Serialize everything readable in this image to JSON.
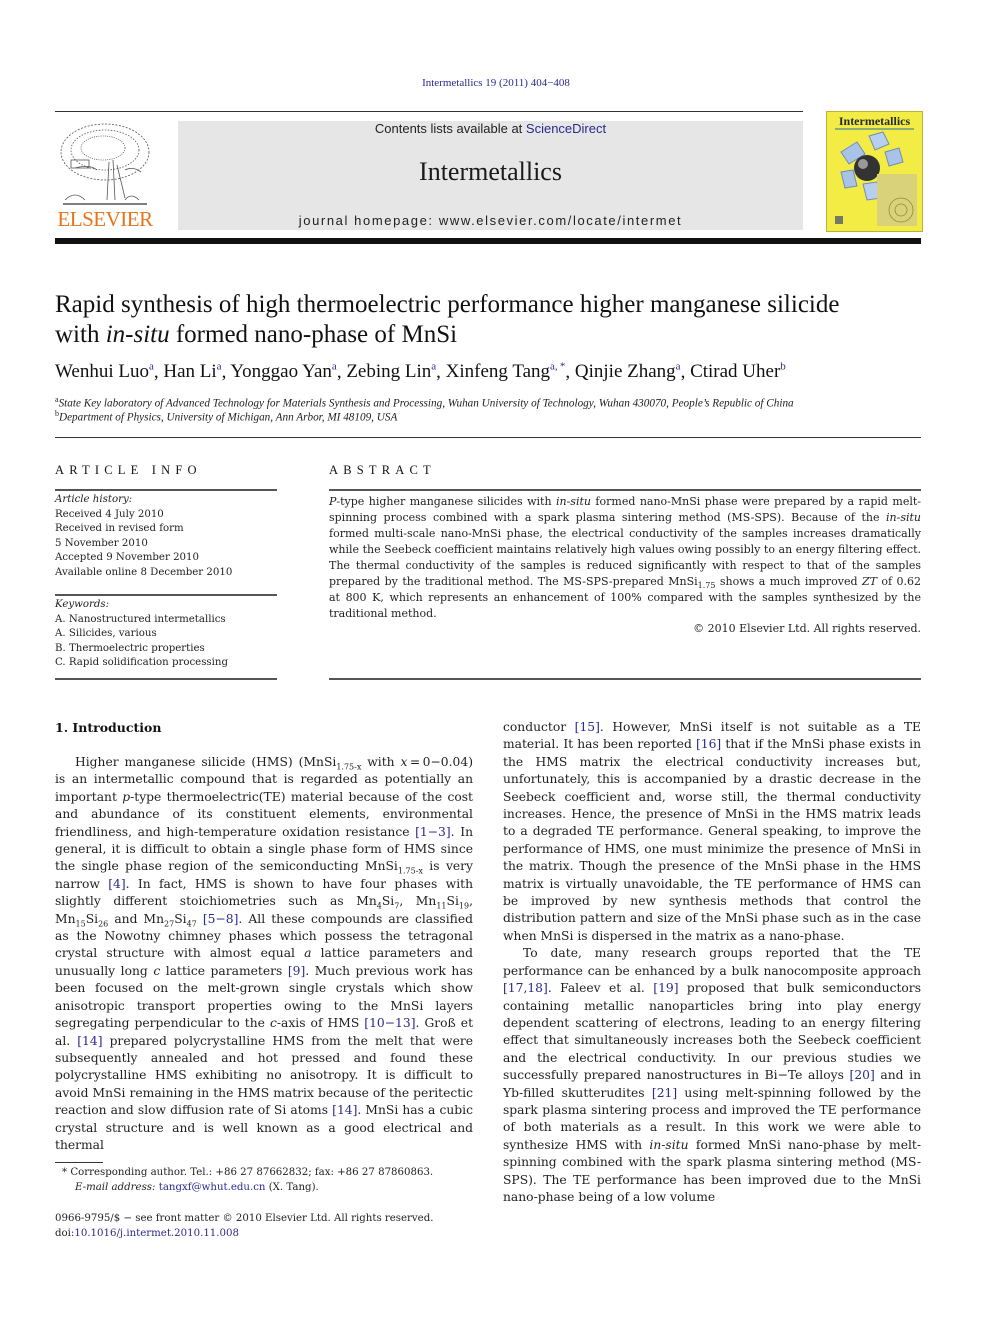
{
  "header": {
    "citation": "Intermetallics 19 (2011) 404−408",
    "contents_prefix": "Contents lists available at ",
    "contents_link": "ScienceDirect",
    "journal_name": "Intermetallics",
    "homepage": "journal homepage: www.elsevier.com/locate/intermet",
    "publisher_logo_text": "ELSEVIER",
    "cover_title": "Intermetallics",
    "colors": {
      "publisher_orange": "#e8731a",
      "banner_gray": "#e6e6e6",
      "cover_yellow": "#f2ec45",
      "link_blue": "#2a2a8c"
    }
  },
  "article": {
    "title_part1": "Rapid synthesis of high thermoelectric performance higher manganese silicide",
    "title_part2_prefix": "with ",
    "title_part2_italic": "in-situ",
    "title_part2_suffix": " formed nano-phase of MnSi",
    "authors": [
      {
        "name": "Wenhui Luo",
        "aff": "a"
      },
      {
        "name": "Han Li",
        "aff": "a"
      },
      {
        "name": "Yonggao Yan",
        "aff": "a"
      },
      {
        "name": "Zebing Lin",
        "aff": "a"
      },
      {
        "name": "Xinfeng Tang",
        "aff": "a, *"
      },
      {
        "name": "Qinjie Zhang",
        "aff": "a"
      },
      {
        "name": "Ctirad Uher",
        "aff": "b"
      }
    ],
    "affiliations": [
      {
        "key": "a",
        "text": "State Key laboratory of Advanced Technology for Materials Synthesis and Processing, Wuhan University of Technology, Wuhan 430070, People’s Republic of China"
      },
      {
        "key": "b",
        "text": "Department of Physics, University of Michigan, Ann Arbor, MI 48109, USA"
      }
    ]
  },
  "article_info": {
    "heading": "ARTICLE INFO",
    "history_label": "Article history:",
    "history": [
      "Received 4 July 2010",
      "Received in revised form",
      "5 November 2010",
      "Accepted 9 November 2010",
      "Available online 8 December 2010"
    ],
    "keywords_label": "Keywords:",
    "keywords": [
      "A. Nanostructured intermetallics",
      "A. Silicides, various",
      "B. Thermoelectric properties",
      "C. Rapid solidification processing"
    ]
  },
  "abstract": {
    "heading": "ABSTRACT",
    "s1_italic": "P",
    "s1_a": "-type higher manganese silicides with ",
    "s1_italic2": "in-situ",
    "s1_b": " formed nano-MnSi phase were prepared by a rapid melt-spinning process combined with a spark plasma sintering method (MS-SPS). Because of the ",
    "s1_italic3": "in-situ",
    "s1_c": " formed multi-scale nano-MnSi phase, the electrical conductivity of the samples increases dramatically while the Seebeck coefficient maintains relatively high values owing possibly to an energy filtering effect. The thermal conductivity of the samples is reduced significantly with respect to that of the samples prepared by the traditional method. The MS-SPS-prepared MnSi",
    "s1_sub": "1.75",
    "s1_d": " shows a much improved ",
    "s1_italic4": "ZT",
    "s1_e": " of 0.62 at 800 K, which represents an enhancement of 100% compared with the samples synthesized by the traditional method.",
    "copyright": "© 2010 Elsevier Ltd. All rights reserved."
  },
  "intro": {
    "heading": "1.  Introduction",
    "left_col_html_parts": {
      "p1": "Higher manganese silicide (HMS) (MnSi<sub>1.75-x</sub> with <i>x</i> = 0−0.04) is an intermetallic compound that is regarded as potentially an important <i>p</i>-type thermoelectric(TE) material because of the cost and abundance of its constituent elements, environmental friendliness, and high-temperature oxidation resistance <span class=\"ref\">[1−3]</span>. In general, it is difficult to obtain a single phase form of HMS since the single phase region of the semiconducting MnSi<sub>1.75-x</sub> is very narrow <span class=\"ref\">[4]</span>. In fact, HMS is shown to have four phases with slightly different stoichiometries such as Mn<sub>4</sub>Si<sub>7</sub>, Mn<sub>11</sub>Si<sub>19</sub>, Mn<sub>15</sub>Si<sub>26</sub> and Mn<sub>27</sub>Si<sub>47</sub> <span class=\"ref\">[5−8]</span>. All these compounds are classified as the Nowotny chimney phases which possess the tetragonal crystal structure with almost equal <i>a</i> lattice parameters and unusually long <i>c</i> lattice parameters <span class=\"ref\">[9]</span>. Much previous work has been focused on the melt-grown single crystals which show anisotropic transport properties owing to the MnSi layers segregating perpendicular to the <i>c</i>-axis of HMS <span class=\"ref\">[10−13]</span>. Groß et al. <span class=\"ref\">[14]</span> prepared polycrystalline HMS from the melt that were subsequently annealed and hot pressed and found these polycrystalline HMS exhibiting no anisotropy. It is difficult to avoid MnSi remaining in the HMS matrix because of the peritectic reaction and slow diffusion rate of Si atoms <span class=\"ref\">[14]</span>. MnSi has a cubic crystal structure and is well known as a good electrical and thermal"
    },
    "right_col_html_parts": {
      "p1": "conductor <span class=\"ref\">[15]</span>. However, MnSi itself is not suitable as a TE material. It has been reported <span class=\"ref\">[16]</span> that if the MnSi phase exists in the HMS matrix the electrical conductivity increases but, unfortunately, this is accompanied by a drastic decrease in the Seebeck coefficient and, worse still, the thermal conductivity increases. Hence, the presence of MnSi in the HMS matrix leads to a degraded TE performance. General speaking, to improve the performance of HMS, one must minimize the presence of MnSi in the matrix. Though the presence of the MnSi phase in the HMS matrix is virtually unavoidable, the TE performance of HMS can be improved by new synthesis methods that control the distribution pattern and size of the MnSi phase such as in the case when MnSi is dispersed in the matrix as a nano-phase.",
      "p2": "To date, many research groups reported that the TE performance can be enhanced by a bulk nanocomposite approach <span class=\"ref\">[17,18]</span>. Faleev et al. <span class=\"ref\">[19]</span> proposed that bulk semiconductors containing metallic nanoparticles bring into play energy dependent scattering of electrons, leading to an energy filtering effect that simultaneously increases both the Seebeck coefficient and the electrical conductivity. In our previous studies we successfully prepared nanostructures in Bi−Te alloys <span class=\"ref\">[20]</span> and in Yb-filled skutterudites <span class=\"ref\">[21]</span> using melt-spinning followed by the spark plasma sintering process and improved the TE performance of both materials as a result. In this work we were able to synthesize HMS with <i>in-situ</i> formed MnSi nano-phase by melt-spinning combined with the spark plasma sintering method (MS-SPS). The TE performance has been improved due to the MnSi nano-phase being of a low volume"
    }
  },
  "footnotes": {
    "corresponding": "*  Corresponding author. Tel.: +86 27 87662832; fax: +86 27 87860863.",
    "email_label": "E-mail address:",
    "email": "tangxf@whut.edu.cn",
    "email_suffix": " (X. Tang).",
    "front_matter": "0966-9795/$ − see front matter © 2010 Elsevier Ltd. All rights reserved.",
    "doi_prefix": "doi:",
    "doi": "10.1016/j.intermet.2010.11.008"
  }
}
